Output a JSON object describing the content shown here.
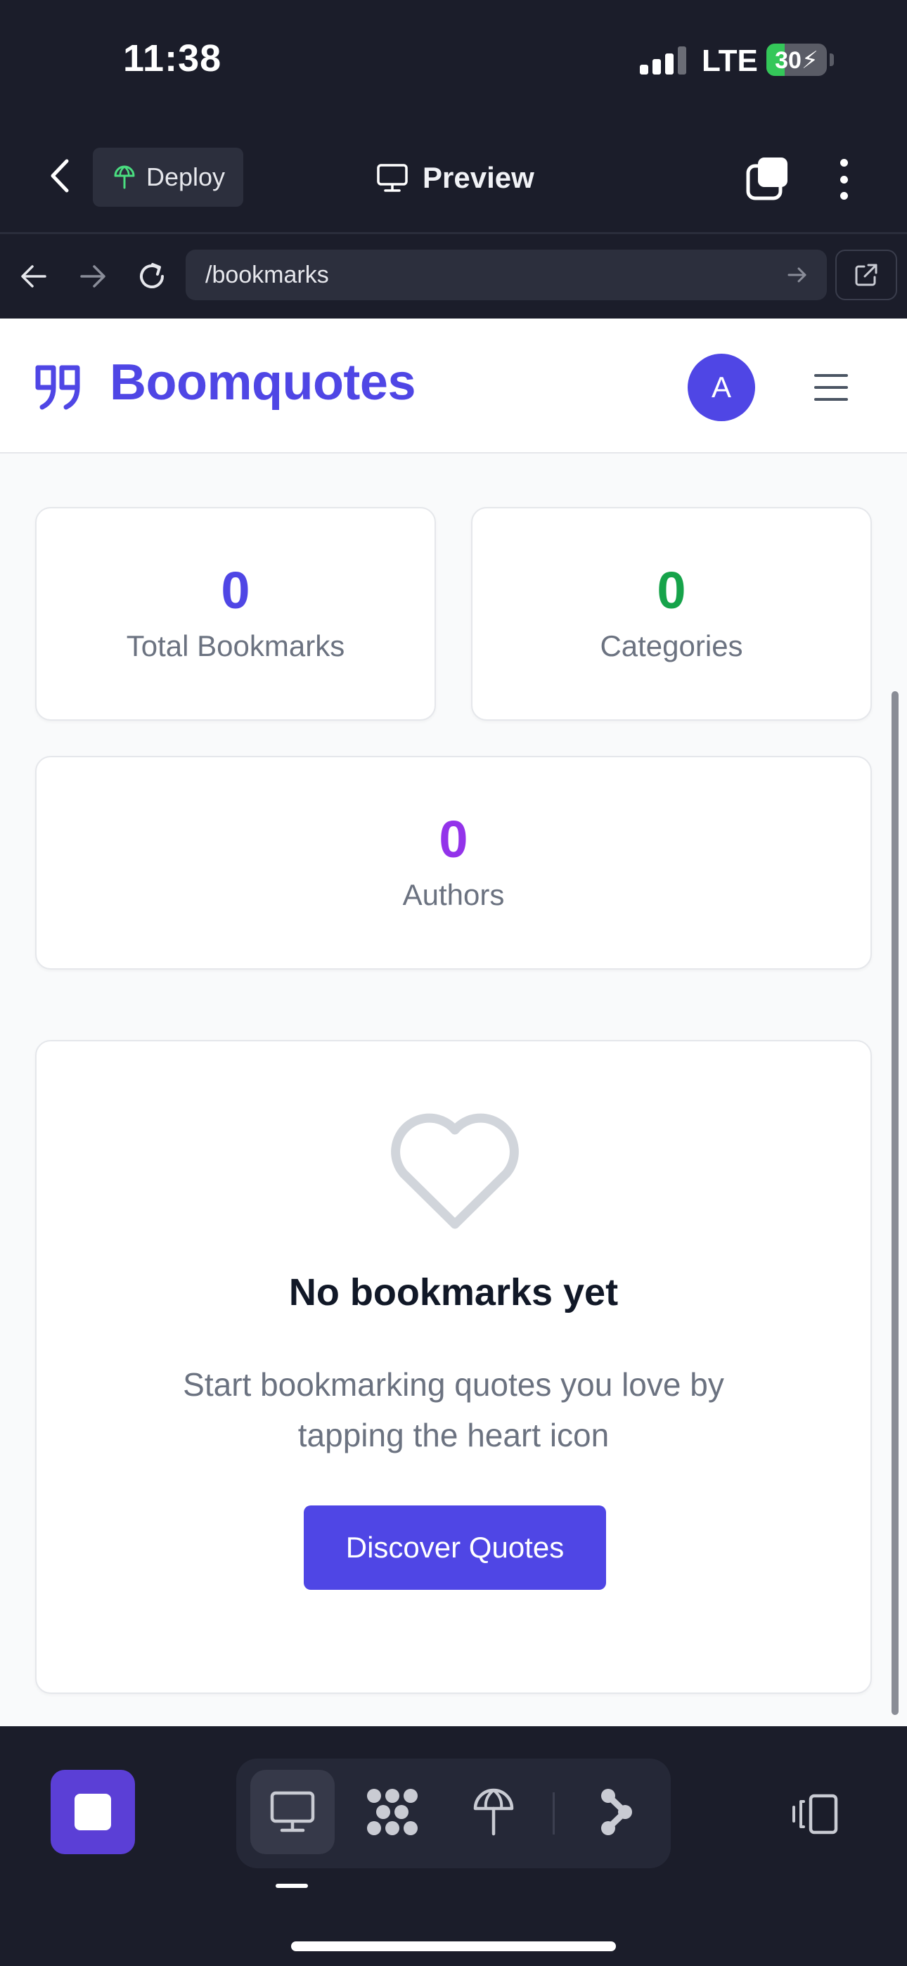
{
  "status_bar": {
    "time": "11:38",
    "network": "LTE",
    "battery_percent": 30,
    "battery_label": "30"
  },
  "toolbar": {
    "back_icon": "chevron-left-icon",
    "deploy_label": "Deploy",
    "preview_label": "Preview",
    "tabs_icon": "tabs-icon",
    "more_icon": "more-vertical-icon"
  },
  "browser": {
    "url": "/bookmarks"
  },
  "site": {
    "brand": "Boomquotes",
    "avatar_initial": "A"
  },
  "stats": [
    {
      "value": "0",
      "label": "Total Bookmarks",
      "color": "#4f46e5"
    },
    {
      "value": "0",
      "label": "Categories",
      "color": "#16a34a"
    },
    {
      "value": "0",
      "label": "Authors",
      "color": "#9333ea"
    }
  ],
  "empty_state": {
    "icon": "heart-icon",
    "title": "No bookmarks yet",
    "description": "Start bookmarking quotes you love by tapping the heart icon",
    "button_label": "Discover Quotes"
  },
  "colors": {
    "brand": "#4f46e5",
    "dark_chrome": "#1b1d2a",
    "accent_purple": "#5b3fd6"
  }
}
